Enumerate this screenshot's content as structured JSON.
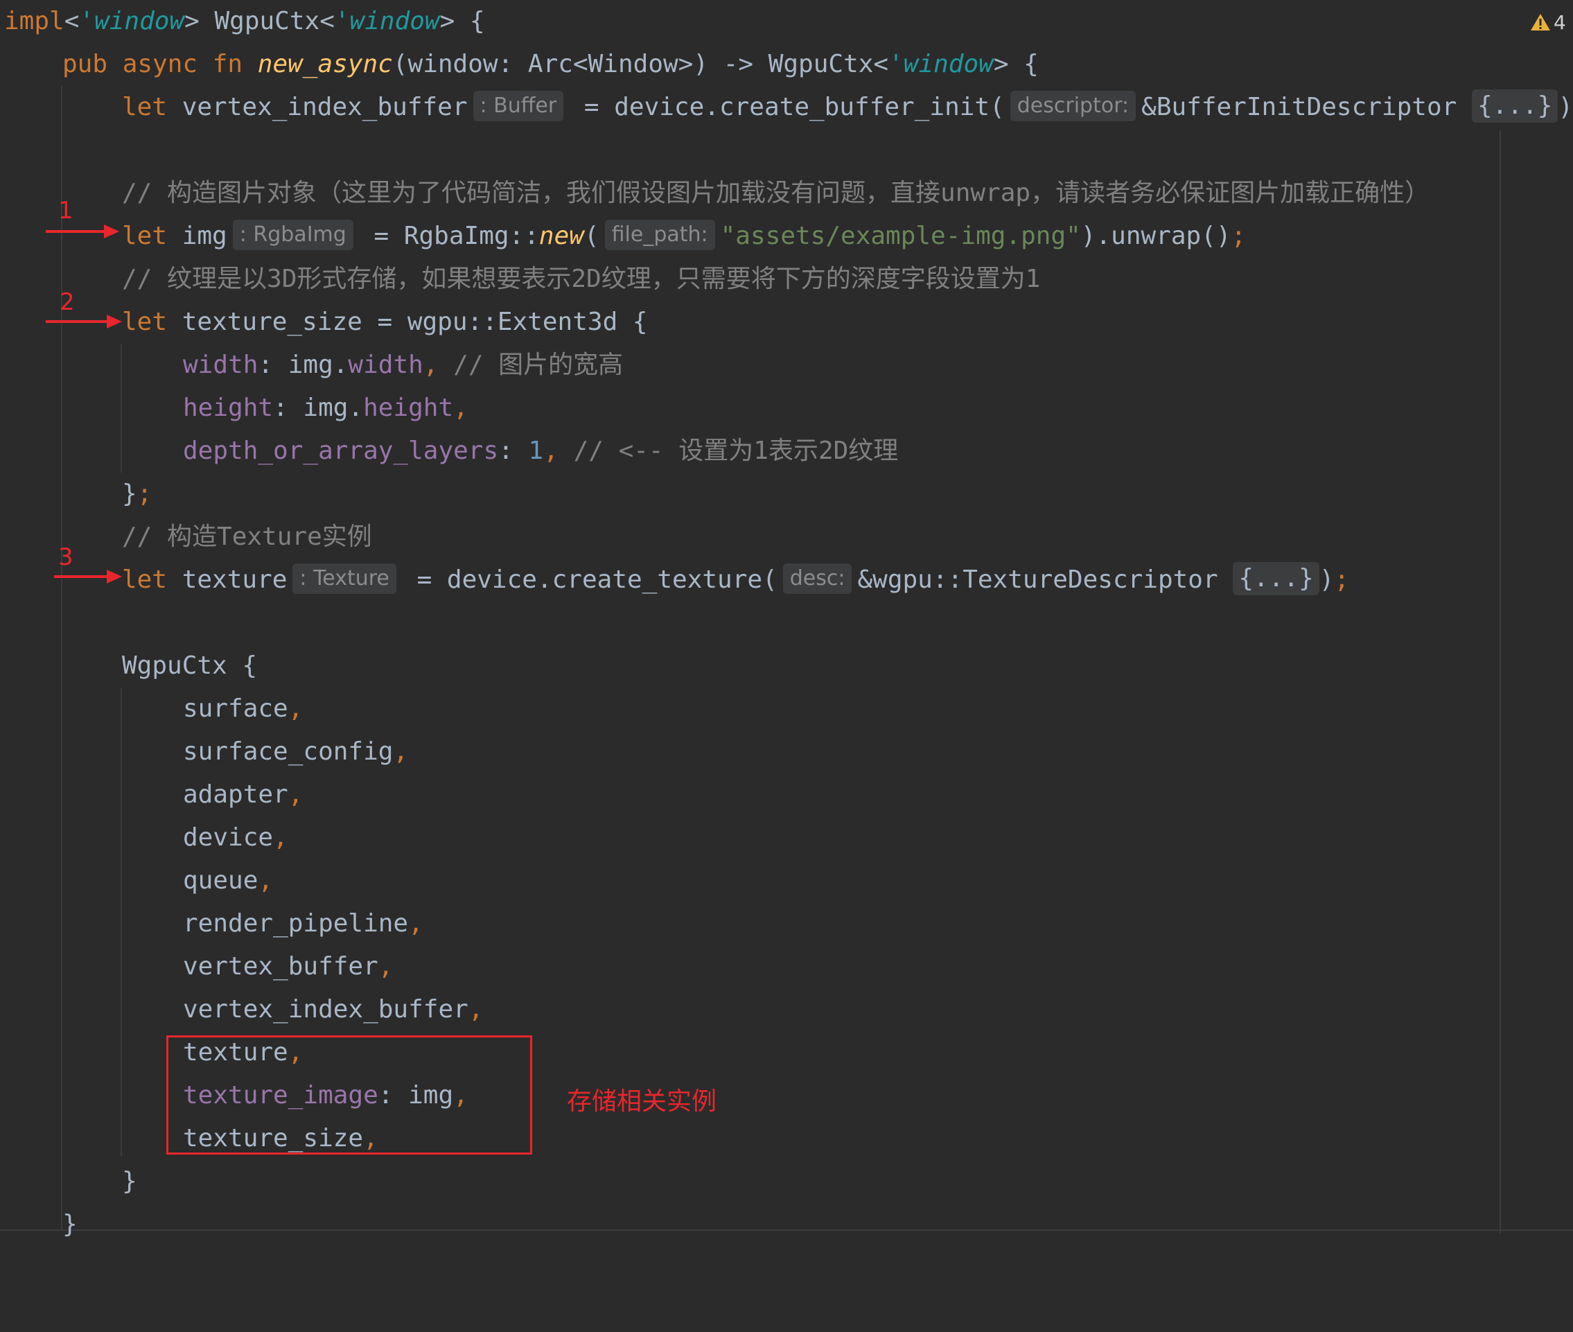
{
  "warnings": {
    "count": "4",
    "icon": "warning-icon",
    "color": "#e8b23a"
  },
  "code": {
    "l1": {
      "impl": "impl",
      "lt_open": "<",
      "lifetime_a": "'window",
      "lt_close": ">",
      "type": " WgpuCtx<",
      "lifetime_b": "'window",
      "tail": "> {"
    },
    "l2": {
      "pub": "pub",
      "async": " async",
      "fn": " fn ",
      "name": "new_async",
      "params": "(window: Arc<Window>) -> WgpuCtx<",
      "lifetime": "'window",
      "tail": "> {"
    },
    "l3": {
      "let": "let",
      "ident": " vertex_index_buffer",
      "hint": ": Buffer",
      "rest": " = device.create_buffer_init(",
      "param_hint": "descriptor:",
      "arg": "&BufferInitDescriptor ",
      "fold": "{...}",
      "close": ")",
      "semi": ";"
    },
    "l5": {
      "comment": "// 构造图片对象（这里为了代码简洁，我们假设图片加载没有问题，直接unwrap，请读者务必保证图片加载正确性）"
    },
    "l6": {
      "let": "let",
      "ident": " img",
      "hint": ": RgbaImg",
      "mid": " = RgbaImg::",
      "fn": "new",
      "open": "(",
      "param_hint": "file_path:",
      "str": "\"assets/example-img.png\"",
      "rest": ").unwrap()",
      "semi": ";"
    },
    "l7": {
      "comment": "// 纹理是以3D形式存储，如果想要表示2D纹理，只需要将下方的深度字段设置为1"
    },
    "l8": {
      "let": "let",
      "rest": " texture_size = wgpu::Extent3d {"
    },
    "l9": {
      "field": "width",
      "colon": ": img.",
      "value": "width",
      "comma": ",",
      "comment": " // 图片的宽高"
    },
    "l10": {
      "field": "height",
      "colon": ": img.",
      "value": "height",
      "comma": ","
    },
    "l11": {
      "field": "depth_or_array_layers",
      "colon": ": ",
      "num": "1",
      "comma": ",",
      "comment": " // <-- 设置为1表示2D纹理"
    },
    "l12": {
      "brace": "}",
      "semi": ";"
    },
    "l13": {
      "comment": "// 构造Texture实例"
    },
    "l14": {
      "let": "let",
      "ident": " texture",
      "hint": ": Texture",
      "rest": " = device.create_texture(",
      "param_hint": "desc:",
      "arg": "&wgpu::TextureDescriptor ",
      "fold": "{...}",
      "close": ")",
      "semi": ";"
    },
    "l16": {
      "text": "WgpuCtx {"
    },
    "fields": [
      {
        "name": "surface",
        "comma": ","
      },
      {
        "name": "surface_config",
        "comma": ","
      },
      {
        "name": "adapter",
        "comma": ","
      },
      {
        "name": "device",
        "comma": ","
      },
      {
        "name": "queue",
        "comma": ","
      },
      {
        "name": "render_pipeline",
        "comma": ","
      },
      {
        "name": "vertex_buffer",
        "comma": ","
      },
      {
        "name": "vertex_index_buffer",
        "comma": ","
      },
      {
        "name": "texture",
        "comma": ","
      }
    ],
    "l26": {
      "field": "texture_image",
      "colon": ": img",
      "comma": ","
    },
    "l27": {
      "name": "texture_size",
      "comma": ","
    },
    "l28": {
      "brace": "}"
    },
    "l29": {
      "brace": "}"
    }
  },
  "annotations": {
    "markers": [
      "1",
      "2",
      "3"
    ],
    "box_label": "存储相关实例",
    "color": "#e8262c"
  }
}
